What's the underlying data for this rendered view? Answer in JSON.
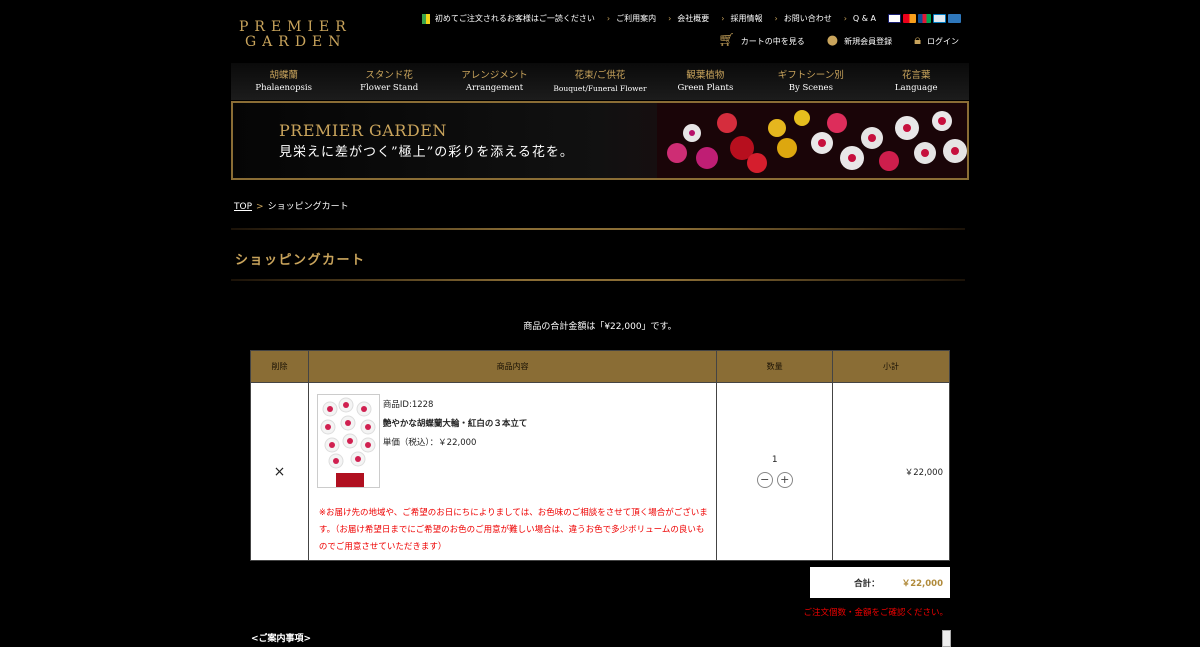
{
  "logo": {
    "line1": "PREMIER",
    "line2": "GARDEN"
  },
  "topnav": [
    {
      "label": "初めてご注文されるお客様はご一読ください",
      "icon": "beginner-mark-icon"
    },
    {
      "label": "ご利用案内"
    },
    {
      "label": "会社概要"
    },
    {
      "label": "採用情報"
    },
    {
      "label": "お問い合わせ"
    },
    {
      "label": "Q & A"
    }
  ],
  "payment_cards": [
    "VISA",
    "MasterCard",
    "JCB",
    "Diners",
    "AMEX"
  ],
  "subnav": {
    "cart": "カートの中を見る",
    "register": "新規会員登録",
    "login": "ログイン"
  },
  "gnav": [
    {
      "jp": "胡蝶蘭",
      "en": "Phalaenopsis"
    },
    {
      "jp": "スタンド花",
      "en": "Flower Stand"
    },
    {
      "jp": "アレンジメント",
      "en": "Arrangement"
    },
    {
      "jp": "花束/ご供花",
      "en": "Bouquet/Funeral Flower"
    },
    {
      "jp": "観葉植物",
      "en": "Green Plants"
    },
    {
      "jp": "ギフトシーン別",
      "en": "By Scenes"
    },
    {
      "jp": "花言葉",
      "en": "Language"
    }
  ],
  "banner": {
    "title": "PREMIER GARDEN",
    "subtitle": "見栄えに差がつく”極上”の彩りを添える花を。"
  },
  "breadcrumb": {
    "top": "TOP",
    "sep": ">",
    "current": "ショッピングカート"
  },
  "page_title": "ショッピングカート",
  "total_message": "商品の合計金額は「¥22,000」です。",
  "table": {
    "headers": {
      "delete": "削除",
      "content": "商品内容",
      "qty": "数量",
      "subtotal": "小計"
    },
    "rows": [
      {
        "delete_symbol": "×",
        "product_id": "商品ID:1228",
        "name": "艶やかな胡蝶蘭大輪・紅白の３本立て",
        "unit_price": "単価（税込）：￥22,000",
        "notice": "※お届け先の地域や、ご希望のお日にちによりましては、お色味のご相談をさせて頂く場合がございます。（お届け希望日までにご希望のお色のご用意が難しい場合は、違うお色で多少ボリュームの良いものでご用意させていただきます）",
        "quantity": "1",
        "minus": "−",
        "plus": "+",
        "subtotal": "￥22,000"
      }
    ]
  },
  "summary": {
    "label": "合計：",
    "amount": "￥22,000"
  },
  "warning": "ご注文個数・金額をご確認ください。",
  "guide_heading": "<ご案内事項>",
  "colors": {
    "gold": "#c9a45c",
    "header_bg": "#8a6d35",
    "red": "#e00000"
  }
}
